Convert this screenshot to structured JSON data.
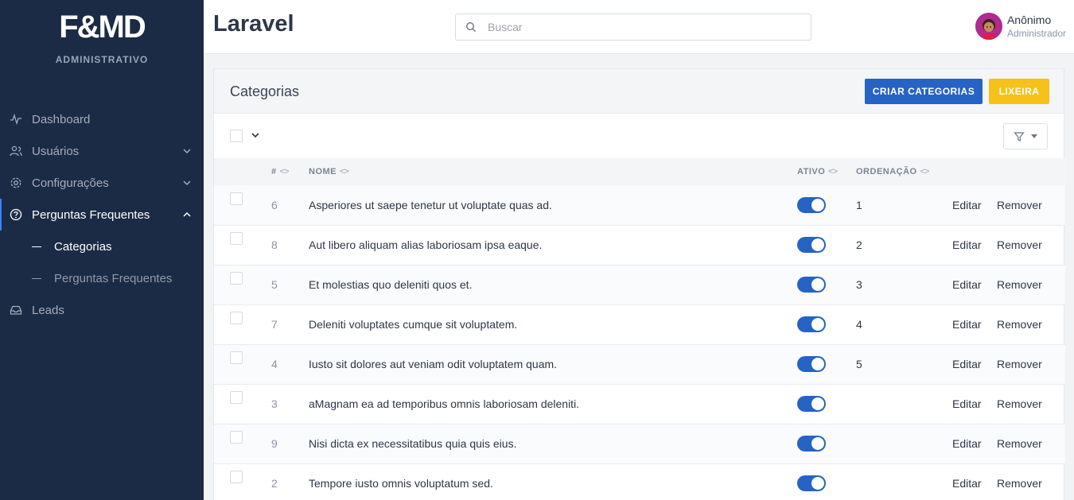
{
  "brand": {
    "logo": "F&MD",
    "subtitle": "ADMINISTRATIVO"
  },
  "sidebar": {
    "items": [
      {
        "label": "Dashboard",
        "icon": "activity-icon"
      },
      {
        "label": "Usuários",
        "icon": "users-icon"
      },
      {
        "label": "Configurações",
        "icon": "gear-icon"
      },
      {
        "label": "Perguntas Frequentes",
        "icon": "help-circle-icon"
      },
      {
        "label": "Leads",
        "icon": "inbox-icon"
      }
    ],
    "subitems": [
      {
        "label": "Categorias"
      },
      {
        "label": "Perguntas Frequentes"
      }
    ]
  },
  "header": {
    "title": "Laravel",
    "search_placeholder": "Buscar",
    "search_value": "",
    "user_name": "Anônimo",
    "user_role": "Administrador"
  },
  "card": {
    "title": "Categorias",
    "create_label": "CRIAR CATEGORIAS",
    "trash_label": "LIXEIRA"
  },
  "table": {
    "columns": {
      "id": "#",
      "name": "NOME",
      "active": "ATIVO",
      "order": "ORDENAÇÃO"
    },
    "sort_glyph": "<>",
    "edit_label": "Editar",
    "remove_label": "Remover",
    "rows": [
      {
        "id": "6",
        "name": "Asperiores ut saepe tenetur ut voluptate quas ad.",
        "active": true,
        "order": "1"
      },
      {
        "id": "8",
        "name": "Aut libero aliquam alias laboriosam ipsa eaque.",
        "active": true,
        "order": "2"
      },
      {
        "id": "5",
        "name": "Et molestias quo deleniti quos et.",
        "active": true,
        "order": "3"
      },
      {
        "id": "7",
        "name": "Deleniti voluptates cumque sit voluptatem.",
        "active": true,
        "order": "4"
      },
      {
        "id": "4",
        "name": "Iusto sit dolores aut veniam odit voluptatem quam.",
        "active": true,
        "order": "5"
      },
      {
        "id": "3",
        "name": "aMagnam ea ad temporibus omnis laboriosam deleniti.",
        "active": true,
        "order": ""
      },
      {
        "id": "9",
        "name": "Nisi dicta ex necessitatibus quia quis eius.",
        "active": true,
        "order": ""
      },
      {
        "id": "2",
        "name": "Tempore iusto omnis voluptatum sed.",
        "active": true,
        "order": ""
      }
    ]
  },
  "colors": {
    "sidebar_bg": "#1c2b45",
    "primary": "#2563c4",
    "warning": "#f6c21a"
  }
}
